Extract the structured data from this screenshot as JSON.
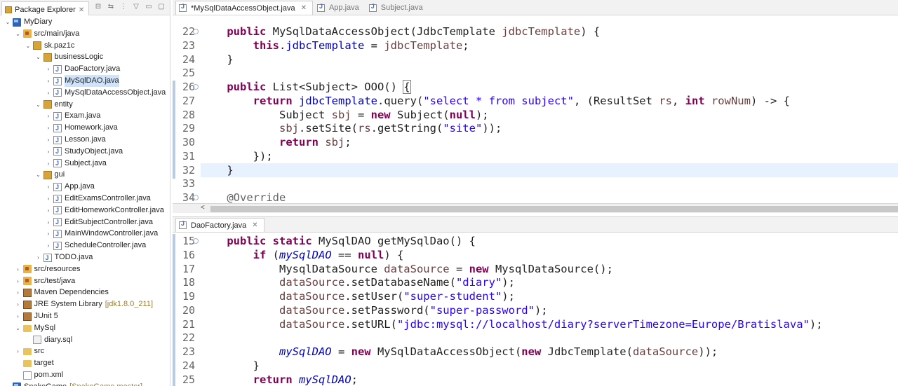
{
  "package_explorer": {
    "tab_label": "Package Explorer",
    "items": [
      {
        "label": "MyDiary",
        "depth": 0,
        "icon": "project",
        "toggle": "v"
      },
      {
        "label": "src/main/java",
        "depth": 1,
        "icon": "srcfolder",
        "toggle": "v"
      },
      {
        "label": "sk.paz1c",
        "depth": 2,
        "icon": "package",
        "toggle": "v"
      },
      {
        "label": "businessLogic",
        "depth": 3,
        "icon": "package",
        "toggle": "v"
      },
      {
        "label": "DaoFactory.java",
        "depth": 4,
        "icon": "java",
        "toggle": ">"
      },
      {
        "label": "MySqlDAO.java",
        "depth": 4,
        "icon": "java",
        "toggle": ">",
        "selected": true
      },
      {
        "label": "MySqlDataAccessObject.java",
        "depth": 4,
        "icon": "java",
        "toggle": ">"
      },
      {
        "label": "entity",
        "depth": 3,
        "icon": "package",
        "toggle": "v"
      },
      {
        "label": "Exam.java",
        "depth": 4,
        "icon": "java",
        "toggle": ">"
      },
      {
        "label": "Homework.java",
        "depth": 4,
        "icon": "java",
        "toggle": ">"
      },
      {
        "label": "Lesson.java",
        "depth": 4,
        "icon": "java",
        "toggle": ">"
      },
      {
        "label": "StudyObject.java",
        "depth": 4,
        "icon": "java",
        "toggle": ">"
      },
      {
        "label": "Subject.java",
        "depth": 4,
        "icon": "java",
        "toggle": ">"
      },
      {
        "label": "gui",
        "depth": 3,
        "icon": "package",
        "toggle": "v"
      },
      {
        "label": "App.java",
        "depth": 4,
        "icon": "java",
        "toggle": ">"
      },
      {
        "label": "EditExamsController.java",
        "depth": 4,
        "icon": "java",
        "toggle": ">"
      },
      {
        "label": "EditHomeworkController.java",
        "depth": 4,
        "icon": "java",
        "toggle": ">"
      },
      {
        "label": "EditSubjectController.java",
        "depth": 4,
        "icon": "java",
        "toggle": ">"
      },
      {
        "label": "MainWindowController.java",
        "depth": 4,
        "icon": "java",
        "toggle": ">"
      },
      {
        "label": "ScheduleController.java",
        "depth": 4,
        "icon": "java",
        "toggle": ">"
      },
      {
        "label": "TODO.java",
        "depth": 3,
        "icon": "java",
        "toggle": ">"
      },
      {
        "label": "src/resources",
        "depth": 1,
        "icon": "srcfolder",
        "toggle": ">"
      },
      {
        "label": "src/test/java",
        "depth": 1,
        "icon": "srcfolder",
        "toggle": ">"
      },
      {
        "label": "Maven Dependencies",
        "depth": 1,
        "icon": "lib",
        "toggle": ">"
      },
      {
        "label": "JRE System Library",
        "depth": 1,
        "icon": "lib",
        "toggle": ">",
        "decoration": "[jdk1.8.0_211]"
      },
      {
        "label": "JUnit 5",
        "depth": 1,
        "icon": "lib",
        "toggle": ">"
      },
      {
        "label": "MySql",
        "depth": 1,
        "icon": "folder",
        "toggle": "v"
      },
      {
        "label": "diary.sql",
        "depth": 2,
        "icon": "sql",
        "toggle": ""
      },
      {
        "label": "src",
        "depth": 1,
        "icon": "folder",
        "toggle": ">"
      },
      {
        "label": "target",
        "depth": 1,
        "icon": "folder",
        "toggle": ""
      },
      {
        "label": "pom.xml",
        "depth": 1,
        "icon": "file",
        "toggle": ""
      },
      {
        "label": "SnakeGame",
        "depth": 0,
        "icon": "project",
        "toggle": ">",
        "decoration": "[SnakeGame master]"
      }
    ]
  },
  "editor1": {
    "tabs": [
      {
        "label": "*MySqlDataAccessObject.java",
        "active": true
      },
      {
        "label": "App.java",
        "active": false
      },
      {
        "label": "Subject.java",
        "active": false
      }
    ],
    "lines": [
      {
        "n": "22",
        "fold": true,
        "html": "    <span class=\"kw\">public</span> MySqlDataAccessObject(JdbcTemplate <span class=\"par\">jdbcTemplate</span>) {"
      },
      {
        "n": "23",
        "html": "        <span class=\"kw\">this</span>.<span class=\"fld\">jdbcTemplate</span> = <span class=\"par\">jdbcTemplate</span>;"
      },
      {
        "n": "24",
        "html": "    }"
      },
      {
        "n": "25",
        "html": ""
      },
      {
        "n": "26",
        "fold": true,
        "changed": true,
        "html": "    <span class=\"kw\">public</span> List&lt;Subject&gt; OOO() <span class=\"bracket\">{</span>"
      },
      {
        "n": "27",
        "changed": true,
        "html": "        <span class=\"kw\">return</span> <span class=\"fld\">jdbcTemplate</span>.query(<span class=\"str\">\"select * from subject\"</span>, (ResultSet <span class=\"par\">rs</span>, <span class=\"kw\">int</span> <span class=\"par\">rowNum</span>) -&gt; {"
      },
      {
        "n": "28",
        "changed": true,
        "html": "            Subject <span class=\"par\">sbj</span> = <span class=\"kw\">new</span> Subject(<span class=\"kw\">null</span>);"
      },
      {
        "n": "29",
        "changed": true,
        "html": "            <span class=\"par\">sbj</span>.setSite(<span class=\"par\">rs</span>.getString(<span class=\"str\">\"site\"</span>));"
      },
      {
        "n": "30",
        "changed": true,
        "html": "            <span class=\"kw\">return</span> <span class=\"par\">sbj</span>;"
      },
      {
        "n": "31",
        "changed": true,
        "html": "        });"
      },
      {
        "n": "32",
        "changed": true,
        "highlight": true,
        "html": "    }"
      },
      {
        "n": "33",
        "html": ""
      },
      {
        "n": "34",
        "fold": true,
        "html": "    <span class=\"ann\">@Override</span>"
      }
    ]
  },
  "editor2": {
    "tabs": [
      {
        "label": "DaoFactory.java",
        "active": true
      }
    ],
    "lines": [
      {
        "n": "15",
        "fold": true,
        "html": "    <span class=\"kw\">public</span> <span class=\"kw\">static</span> MySqlDAO getMySqlDao() {"
      },
      {
        "n": "16",
        "html": "        <span class=\"kw\">if</span> (<span class=\"sfld\">mySqlDAO</span> == <span class=\"kw\">null</span>) {"
      },
      {
        "n": "17",
        "html": "            MysqlDataSource <span class=\"par\">dataSource</span> = <span class=\"kw\">new</span> MysqlDataSource();"
      },
      {
        "n": "18",
        "html": "            <span class=\"par\">dataSource</span>.setDatabaseName(<span class=\"str\">\"diary\"</span>);"
      },
      {
        "n": "19",
        "html": "            <span class=\"par\">dataSource</span>.setUser(<span class=\"str\">\"super-student\"</span>);"
      },
      {
        "n": "20",
        "html": "            <span class=\"par\">dataSource</span>.setPassword(<span class=\"str\">\"super-password\"</span>);"
      },
      {
        "n": "21",
        "html": "            <span class=\"par\">dataSource</span>.setURL(<span class=\"str\">\"jdbc:mysql://localhost/diary?serverTimezone=Europe/Bratislava\"</span>);"
      },
      {
        "n": "22",
        "html": ""
      },
      {
        "n": "23",
        "html": "            <span class=\"sfld\">mySqlDAO</span> = <span class=\"kw\">new</span> MySqlDataAccessObject(<span class=\"kw\">new</span> JdbcTemplate(<span class=\"par\">dataSource</span>));"
      },
      {
        "n": "24",
        "html": "        }"
      },
      {
        "n": "25",
        "html": "        <span class=\"kw\">return</span> <span class=\"sfld\">mySqlDAO</span>;"
      }
    ]
  }
}
